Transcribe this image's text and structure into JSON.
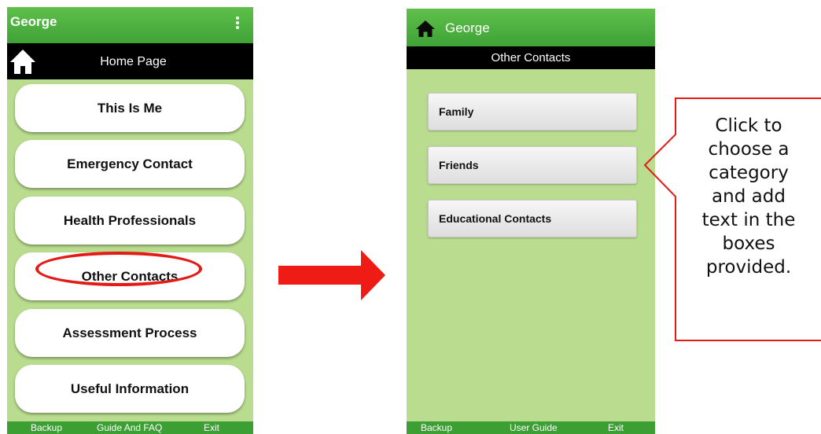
{
  "left_screen": {
    "app_title": "George",
    "page_title": "Home Page",
    "menu": [
      {
        "label": "This Is Me"
      },
      {
        "label": "Emergency Contact"
      },
      {
        "label": "Health Professionals"
      },
      {
        "label": "Other Contacts"
      },
      {
        "label": "Assessment Process"
      },
      {
        "label": "Useful Information"
      }
    ],
    "footer": {
      "backup": "Backup",
      "guide": "Guide And FAQ",
      "exit": "Exit"
    }
  },
  "right_screen": {
    "app_title": "George",
    "page_title": "Other Contacts",
    "categories": [
      {
        "label": "Family"
      },
      {
        "label": "Friends"
      },
      {
        "label": "Educational Contacts"
      }
    ],
    "footer": {
      "backup": "Backup",
      "guide": "User Guide",
      "exit": "Exit"
    }
  },
  "callout": {
    "lines": [
      "Click to",
      "choose a",
      "category",
      "and add",
      "text in the",
      "boxes",
      "provided."
    ]
  },
  "colors": {
    "app_green": "#3ea236",
    "screen_bg": "#b9dc8e",
    "highlight_red": "#e31b17"
  },
  "icons": {
    "home": "home-icon",
    "menu": "kebab-menu-icon",
    "arrow": "right-arrow-icon"
  }
}
